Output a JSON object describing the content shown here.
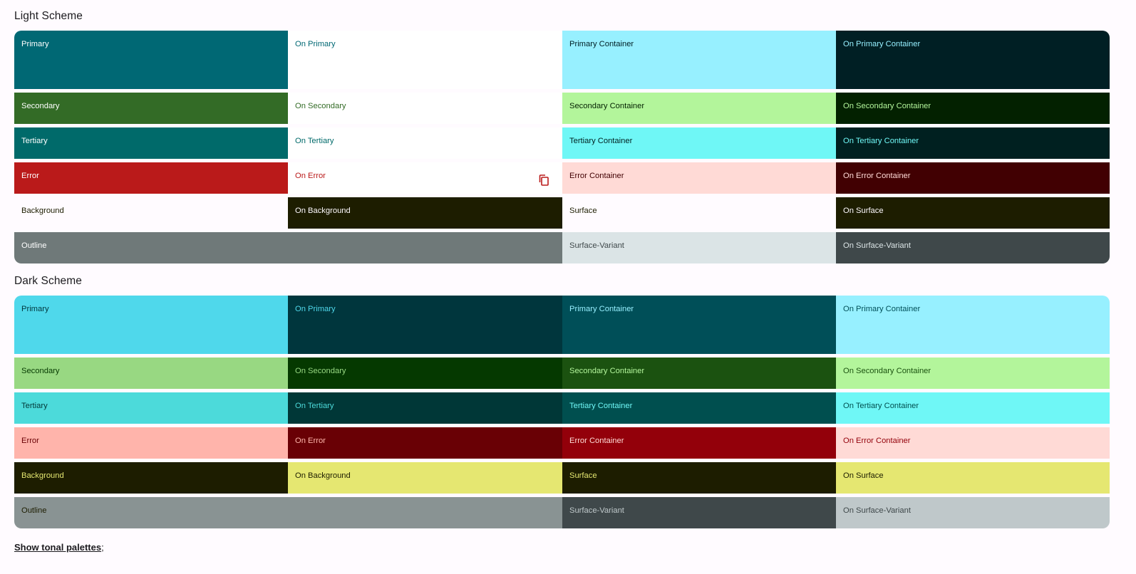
{
  "light": {
    "title": "Light Scheme",
    "rows": [
      [
        {
          "label": "Primary",
          "bg": "#006874",
          "fg": "#ffffff"
        },
        {
          "label": "On Primary",
          "bg": "#ffffff",
          "fg": "#006874"
        },
        {
          "label": "Primary Container",
          "bg": "#97f0ff",
          "fg": "#001f24"
        },
        {
          "label": "On Primary Container",
          "bg": "#001f24",
          "fg": "#97f0ff"
        }
      ],
      [
        {
          "label": "Secondary",
          "bg": "#336b26",
          "fg": "#ffffff"
        },
        {
          "label": "On Secondary",
          "bg": "#ffffff",
          "fg": "#336b26"
        },
        {
          "label": "Secondary Container",
          "bg": "#b3f59b",
          "fg": "#032100"
        },
        {
          "label": "On Secondary Container",
          "bg": "#032100",
          "fg": "#b3f59b"
        }
      ],
      [
        {
          "label": "Tertiary",
          "bg": "#006a6a",
          "fg": "#ffffff"
        },
        {
          "label": "On Tertiary",
          "bg": "#ffffff",
          "fg": "#006a6a"
        },
        {
          "label": "Tertiary Container",
          "bg": "#6ff7f6",
          "fg": "#002020"
        },
        {
          "label": "On Tertiary Container",
          "bg": "#002020",
          "fg": "#6ff7f6"
        }
      ],
      [
        {
          "label": "Error",
          "bg": "#ba1a1a",
          "fg": "#ffffff"
        },
        {
          "label": "On Error",
          "bg": "#ffffff",
          "fg": "#ba1a1a",
          "icon": "copy-icon"
        },
        {
          "label": "Error Container",
          "bg": "#ffdad6",
          "fg": "#410002"
        },
        {
          "label": "On Error Container",
          "bg": "#410002",
          "fg": "#ffdad6"
        }
      ],
      [
        {
          "label": "Background",
          "bg": "#fffbff",
          "fg": "#1d1d00"
        },
        {
          "label": "On Background",
          "bg": "#1d1d00",
          "fg": "#fffbff"
        },
        {
          "label": "Surface",
          "bg": "#fffbff",
          "fg": "#1d1d00"
        },
        {
          "label": "On Surface",
          "bg": "#1d1d00",
          "fg": "#fffbff"
        }
      ],
      [
        {
          "label": "Outline",
          "bg": "#6f7979",
          "fg": "#ffffff",
          "span": 2
        },
        {
          "label": "Surface-Variant",
          "bg": "#dbe4e6",
          "fg": "#3f484a"
        },
        {
          "label": "On Surface-Variant",
          "bg": "#3f484a",
          "fg": "#dbe4e6"
        }
      ]
    ]
  },
  "dark": {
    "title": "Dark Scheme",
    "rows": [
      [
        {
          "label": "Primary",
          "bg": "#4fd8eb",
          "fg": "#00363d"
        },
        {
          "label": "On Primary",
          "bg": "#00363d",
          "fg": "#4fd8eb"
        },
        {
          "label": "Primary Container",
          "bg": "#004f58",
          "fg": "#97f0ff"
        },
        {
          "label": "On Primary Container",
          "bg": "#97f0ff",
          "fg": "#004f58"
        }
      ],
      [
        {
          "label": "Secondary",
          "bg": "#98d882",
          "fg": "#053900"
        },
        {
          "label": "On Secondary",
          "bg": "#053900",
          "fg": "#98d882"
        },
        {
          "label": "Secondary Container",
          "bg": "#1b5210",
          "fg": "#b3f59b"
        },
        {
          "label": "On Secondary Container",
          "bg": "#b3f59b",
          "fg": "#1b5210"
        }
      ],
      [
        {
          "label": "Tertiary",
          "bg": "#4cdada",
          "fg": "#003737"
        },
        {
          "label": "On Tertiary",
          "bg": "#003737",
          "fg": "#4cdada"
        },
        {
          "label": "Tertiary Container",
          "bg": "#004f4f",
          "fg": "#6ff7f6"
        },
        {
          "label": "On Tertiary Container",
          "bg": "#6ff7f6",
          "fg": "#004f4f"
        }
      ],
      [
        {
          "label": "Error",
          "bg": "#ffb4ab",
          "fg": "#690005"
        },
        {
          "label": "On Error",
          "bg": "#690005",
          "fg": "#ffb4ab"
        },
        {
          "label": "Error Container",
          "bg": "#93000a",
          "fg": "#ffdad6"
        },
        {
          "label": "On Error Container",
          "bg": "#ffdad6",
          "fg": "#93000a"
        }
      ],
      [
        {
          "label": "Background",
          "bg": "#1d1d00",
          "fg": "#e5e771"
        },
        {
          "label": "On Background",
          "bg": "#e5e771",
          "fg": "#1d1d00"
        },
        {
          "label": "Surface",
          "bg": "#1d1d00",
          "fg": "#e5e771"
        },
        {
          "label": "On Surface",
          "bg": "#e5e771",
          "fg": "#1d1d00"
        }
      ],
      [
        {
          "label": "Outline",
          "bg": "#899393",
          "fg": "#1d1d00",
          "span": 2
        },
        {
          "label": "Surface-Variant",
          "bg": "#3f484a",
          "fg": "#bfc8ca"
        },
        {
          "label": "On Surface-Variant",
          "bg": "#bfc8ca",
          "fg": "#3f484a"
        }
      ]
    ]
  },
  "footer": {
    "link_label": "Show tonal palettes",
    "suffix": ";"
  }
}
